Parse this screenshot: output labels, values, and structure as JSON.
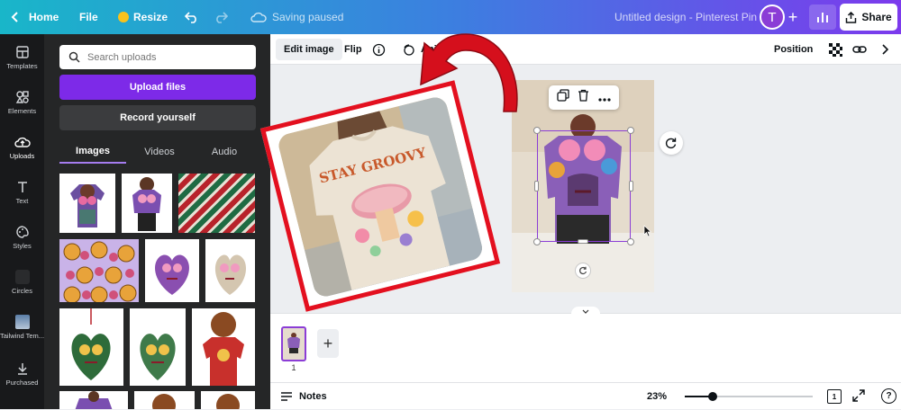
{
  "topbar": {
    "home": "Home",
    "file": "File",
    "resize": "Resize",
    "status": "Saving paused",
    "title": "Untitled design - Pinterest Pin",
    "avatar_letter": "T",
    "share": "Share"
  },
  "rail": {
    "items": [
      {
        "label": "Templates",
        "icon": "templates-icon"
      },
      {
        "label": "Elements",
        "icon": "elements-icon"
      },
      {
        "label": "Uploads",
        "icon": "uploads-icon"
      },
      {
        "label": "Text",
        "icon": "text-icon"
      },
      {
        "label": "Styles",
        "icon": "styles-icon"
      },
      {
        "label": "Circles",
        "icon": "circles-icon"
      },
      {
        "label": "Tailwind Tem...",
        "icon": "tailwind-icon"
      },
      {
        "label": "Purchased",
        "icon": "purchased-icon"
      }
    ]
  },
  "panel": {
    "search_placeholder": "Search uploads",
    "upload_button": "Upload files",
    "record_button": "Record yourself",
    "tabs": [
      "Images",
      "Videos",
      "Audio"
    ]
  },
  "canvas_toolbar": {
    "edit_image": "Edit image",
    "flip": "Flip",
    "animate": "Anim",
    "position": "Position"
  },
  "overlay_shirt": {
    "shirt_text": "STAY GROOVY"
  },
  "pages": {
    "page_number": "1"
  },
  "bottombar": {
    "notes": "Notes",
    "zoom": "23%",
    "zoom_fraction": 0.22,
    "page_count": "1"
  },
  "colors": {
    "accent": "#7d2ae8",
    "highlight_red": "#e3101f",
    "selection": "#8b3dd6"
  }
}
